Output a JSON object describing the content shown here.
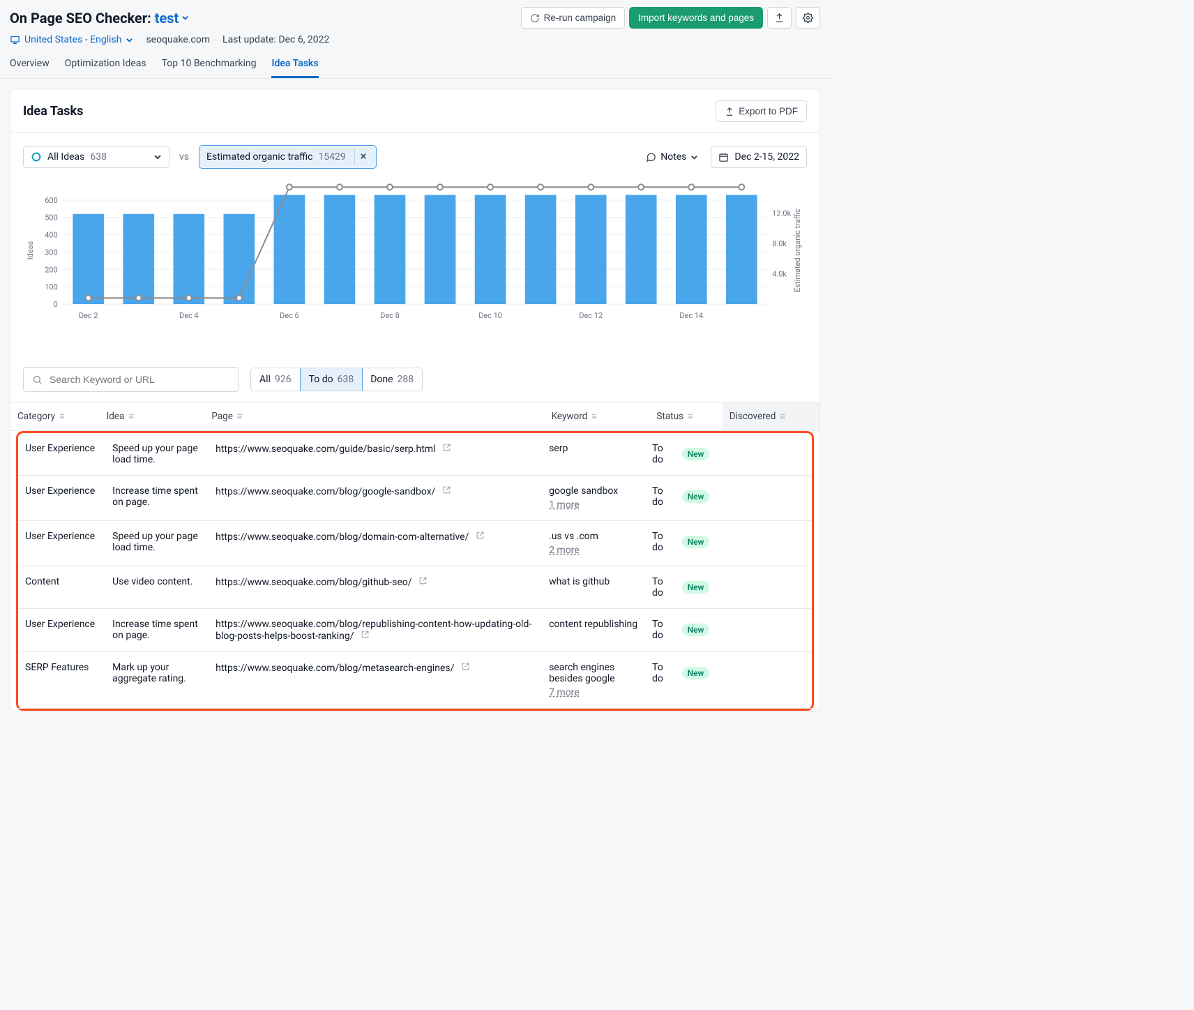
{
  "header": {
    "tool_name": "On Page SEO Checker:",
    "project": "test",
    "rerun": "Re-run campaign",
    "import": "Import keywords and pages",
    "location": "United States - English",
    "domain": "seoquake.com",
    "last_update": "Last update: Dec 6, 2022"
  },
  "tabs": [
    "Overview",
    "Optimization Ideas",
    "Top 10 Benchmarking",
    "Idea Tasks"
  ],
  "card": {
    "title": "Idea Tasks",
    "export": "Export to PDF"
  },
  "controls": {
    "ideas_label": "All Ideas",
    "ideas_count": "638",
    "vs": "vs",
    "chip_label": "Estimated organic traffic",
    "chip_value": "15429",
    "notes": "Notes",
    "date_range": "Dec 2-15, 2022"
  },
  "chart_data": {
    "type": "bar",
    "categories": [
      "Dec 2",
      "Dec 3",
      "Dec 4",
      "Dec 5",
      "Dec 6",
      "Dec 7",
      "Dec 8",
      "Dec 9",
      "Dec 10",
      "Dec 11",
      "Dec 12",
      "Dec 13",
      "Dec 14",
      "Dec 15"
    ],
    "x_ticks": [
      "Dec 2",
      "Dec 4",
      "Dec 6",
      "Dec 8",
      "Dec 10",
      "Dec 12",
      "Dec 14"
    ],
    "series": [
      {
        "name": "Ideas",
        "type": "bar",
        "axis": "left",
        "values": [
          520,
          520,
          520,
          520,
          630,
          630,
          630,
          630,
          630,
          630,
          630,
          630,
          630,
          630
        ]
      },
      {
        "name": "Estimated organic traffic",
        "type": "line",
        "axis": "right",
        "values": [
          800,
          800,
          800,
          800,
          15429,
          15429,
          15429,
          15429,
          15429,
          15429,
          15429,
          15429,
          15429,
          15429
        ]
      }
    ],
    "ylabel_left": "Ideas",
    "ylabel_right": "Estimated organic traffic",
    "ylim_left": [
      0,
      700
    ],
    "y_ticks_left": [
      0,
      100,
      200,
      300,
      400,
      500,
      600
    ],
    "ylim_right": [
      0,
      16000
    ],
    "y_ticks_right": [
      "4.0k",
      "8.0k",
      "12.0k"
    ]
  },
  "search": {
    "placeholder": "Search Keyword or URL"
  },
  "filters": {
    "all_label": "All",
    "all_count": "926",
    "todo_label": "To do",
    "todo_count": "638",
    "done_label": "Done",
    "done_count": "288"
  },
  "columns": {
    "category": "Category",
    "idea": "Idea",
    "page": "Page",
    "keyword": "Keyword",
    "status": "Status",
    "discovered": "Discovered"
  },
  "rows": [
    {
      "cat": "User Experience",
      "cat_cls": "cat-ux",
      "idea": "Speed up your page load time.",
      "page": "https://www.seoquake.com/guide/basic/serp.html",
      "kw": "serp",
      "more": "",
      "status": "To do",
      "badge": "New"
    },
    {
      "cat": "User Experience",
      "cat_cls": "cat-ux",
      "idea": "Increase time spent on page.",
      "page": "https://www.seoquake.com/blog/google-sandbox/",
      "kw": "google sandbox",
      "more": "1 more",
      "status": "To do",
      "badge": "New"
    },
    {
      "cat": "User Experience",
      "cat_cls": "cat-ux",
      "idea": "Speed up your page load time.",
      "page": "https://www.seoquake.com/blog/domain-com-alternative/",
      "kw": ".us vs .com",
      "more": "2 more",
      "status": "To do",
      "badge": "New"
    },
    {
      "cat": "Content",
      "cat_cls": "cat-content",
      "idea": "Use video content.",
      "page": "https://www.seoquake.com/blog/github-seo/",
      "kw": "what is github",
      "more": "",
      "status": "To do",
      "badge": "New"
    },
    {
      "cat": "User Experience",
      "cat_cls": "cat-ux",
      "idea": "Increase time spent on page.",
      "page": "https://www.seoquake.com/blog/republishing-content-how-updating-old-blog-posts-helps-boost-ranking/",
      "kw": "content republishing",
      "more": "",
      "status": "To do",
      "badge": "New"
    },
    {
      "cat": "SERP Features",
      "cat_cls": "cat-serp",
      "idea": "Mark up your aggregate rating.",
      "page": "https://www.seoquake.com/blog/metasearch-engines/",
      "kw": "search engines besides google",
      "more": "7 more",
      "status": "To do",
      "badge": "New"
    }
  ]
}
